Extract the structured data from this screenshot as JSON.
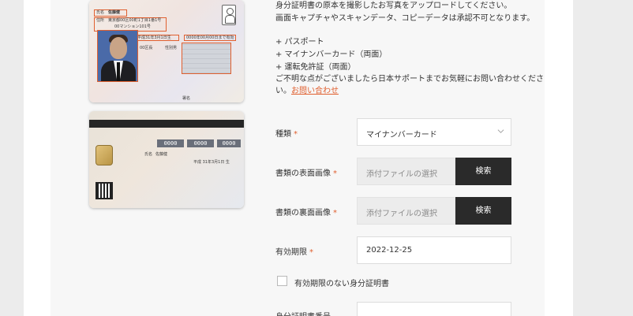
{
  "instructions": {
    "line1": "身分証明書の原本を撮影したお写真をアップロードしてください。",
    "line2": "画面キャプチャやスキャンデータ、コピーデータは承認不可となります。",
    "doc1": "+ パスポート",
    "doc2": "+ マイナンバーカード（両面）",
    "doc3": "+ 運転免許証（両面）",
    "help_line1": "ご不明な点がございましたら日本サポートまでお気軽にお問い合わせくださ",
    "help_line2_prefix": "い。",
    "help_link": "お問い合わせ"
  },
  "card_front": {
    "name_label": "氏名",
    "name_value": "佐藤健",
    "address_label": "住所",
    "address_line1": "東京都00区00町1丁目1番1号",
    "address_line2": "00マンション101号",
    "birth": "平成31年3月1日生",
    "expiry": "0000年00月00日まで有効",
    "city": "00区長",
    "sex_label": "性別",
    "sex_value": "男",
    "seal": "署名"
  },
  "card_back": {
    "number_groups": [
      "0000",
      "0000",
      "0000"
    ],
    "name_label": "氏名",
    "name_value": "佐藤健",
    "birth": "平成 31年3月1日 生"
  },
  "form": {
    "type_label": "種類",
    "type_value": "マイナンバーカード",
    "front_label": "書類の表面画像",
    "front_placeholder": "添付ファイルの選択",
    "front_button": "検索",
    "back_label": "書類の裏面画像",
    "back_placeholder": "添付ファイルの選択",
    "back_button": "検索",
    "expiry_label": "有効期限",
    "expiry_value": "2022-12-25",
    "no_expiry_label": "有効期限のない身分証明書",
    "id_number_label": "身分証明書番号",
    "required_mark": "*"
  },
  "colors": {
    "accent": "#e06030",
    "button": "#2a2a2a",
    "panel": "#f7f7f7",
    "page": "#ececec"
  }
}
